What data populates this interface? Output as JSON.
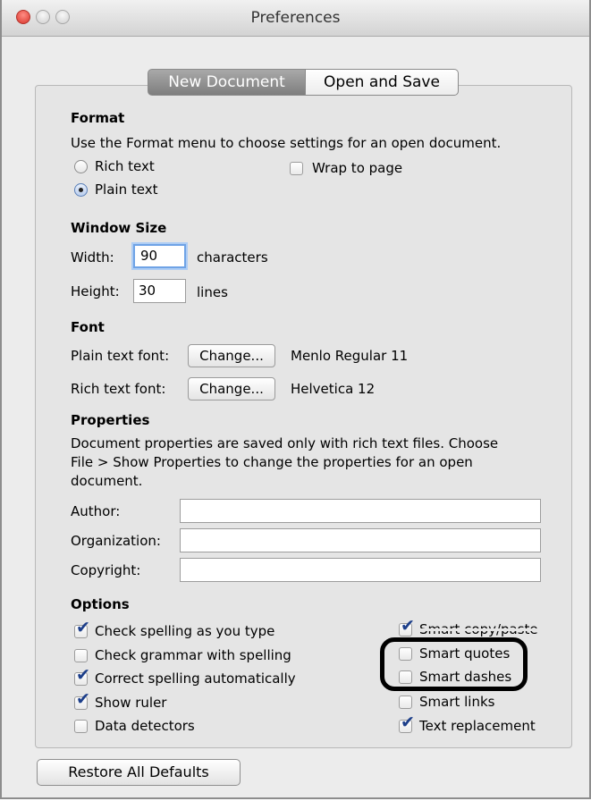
{
  "window": {
    "title": "Preferences"
  },
  "tabs": [
    {
      "label": "New Document"
    },
    {
      "label": "Open and Save"
    }
  ],
  "format": {
    "heading": "Format",
    "description": "Use the Format menu to choose settings for an open document.",
    "rich_text": "Rich text",
    "plain_text": "Plain text",
    "wrap_to_page": "Wrap to page",
    "selected": "Plain text"
  },
  "window_size": {
    "heading": "Window Size",
    "width_label": "Width:",
    "width_value": "90",
    "width_unit": "characters",
    "height_label": "Height:",
    "height_value": "30",
    "height_unit": "lines"
  },
  "font": {
    "heading": "Font",
    "plain_label": "Plain text font:",
    "plain_button": "Change...",
    "plain_value": "Menlo Regular 11",
    "rich_label": "Rich text font:",
    "rich_button": "Change...",
    "rich_value": "Helvetica 12"
  },
  "properties": {
    "heading": "Properties",
    "description_line1": "Document properties are saved only with rich text files. Choose",
    "description_line2": "File > Show Properties to change the properties for an open",
    "description_line3": "document.",
    "author_label": "Author:",
    "author_value": "",
    "organization_label": "Organization:",
    "organization_value": "",
    "copyright_label": "Copyright:",
    "copyright_value": ""
  },
  "options": {
    "heading": "Options",
    "check_spelling": {
      "label": "Check spelling as you type",
      "checked": true
    },
    "check_grammar": {
      "label": "Check grammar with spelling",
      "checked": false
    },
    "correct_spelling": {
      "label": "Correct spelling automatically",
      "checked": true
    },
    "show_ruler": {
      "label": "Show ruler",
      "checked": true
    },
    "data_detectors": {
      "label": "Data detectors",
      "checked": false
    },
    "smart_copy_paste": {
      "label": "Smart copy/paste",
      "checked": true
    },
    "smart_quotes": {
      "label": "Smart quotes",
      "checked": false
    },
    "smart_dashes": {
      "label": "Smart dashes",
      "checked": false
    },
    "smart_links": {
      "label": "Smart links",
      "checked": false
    },
    "text_replacement": {
      "label": "Text replacement",
      "checked": true
    }
  },
  "footer": {
    "restore_button": "Restore All Defaults"
  }
}
